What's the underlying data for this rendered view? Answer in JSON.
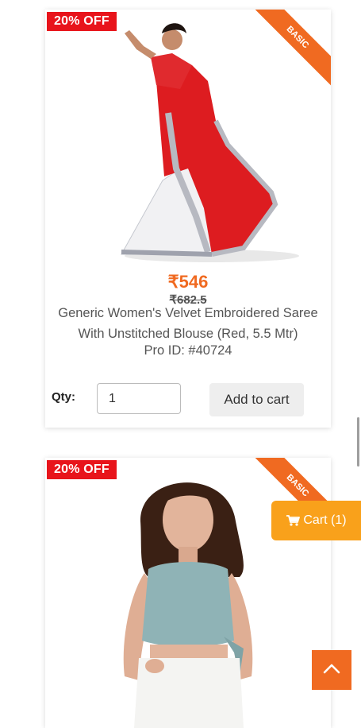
{
  "products": [
    {
      "discount_badge": "20% OFF",
      "ribbon": "BASIC",
      "price": "₹546",
      "old_price": "₹682.5",
      "title": "Generic Women's Velvet Embroidered Saree With Unstitched Blouse (Red, 5.5 Mtr)",
      "pro_id": "Pro ID: #40724",
      "qty_label": "Qty:",
      "qty_value": "1",
      "add_to_cart": "Add to cart",
      "image": "red-white-saree-model"
    },
    {
      "discount_badge": "20% OFF",
      "ribbon": "BASIC",
      "image": "blue-crop-top-model"
    }
  ],
  "cart_button": {
    "label": "Cart (1)",
    "icon": "cart-icon",
    "color": "#f9a11b"
  },
  "scroll_top": {
    "icon": "chevron-up-icon",
    "color": "#f06a21"
  },
  "colors": {
    "accent": "#f06a21",
    "badge": "#e8141b"
  }
}
